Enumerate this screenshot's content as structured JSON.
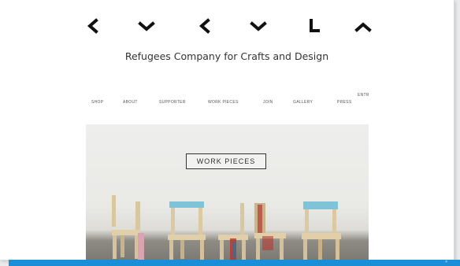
{
  "site": {
    "tagline": "Refugees Company for Crafts and Design"
  },
  "nav": {
    "items": [
      "SHOP",
      "ABOUT",
      "SUPPORTER",
      "WORK PIECES",
      "JOIN",
      "GALLERY",
      "PRESS"
    ],
    "extra": "ENTR"
  },
  "hero": {
    "label": "WORK PIECES"
  },
  "colors": {
    "statusbar": "#1a8fd8",
    "chair_accent_blue": "#7fc3d8",
    "chair_accent_pink": "#d9a3b4",
    "chair_accent_red": "#b43a33"
  },
  "logo": {
    "glyphs": [
      "left-angle-icon",
      "down-chevron-icon",
      "left-angle-icon",
      "down-chevron-icon",
      "corner-icon",
      "up-chevron-icon"
    ]
  }
}
